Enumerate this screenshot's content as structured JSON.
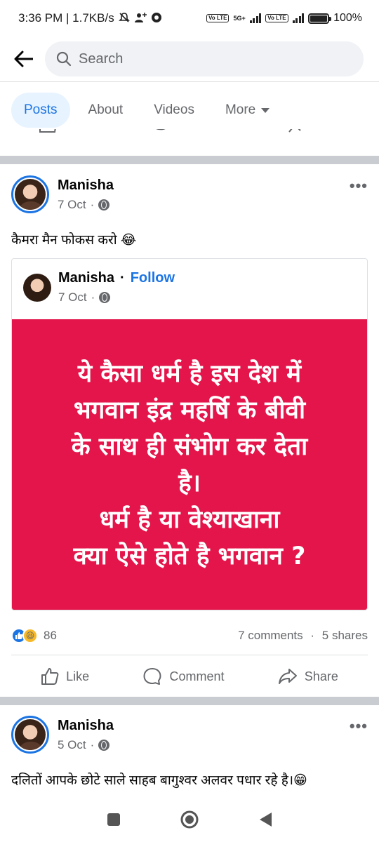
{
  "status_bar": {
    "time_info": "3:36 PM | 1.7KB/s",
    "battery": "100%",
    "battery_level": 1.0,
    "network_label": "5G+",
    "volte_label": "Vo LTE"
  },
  "search": {
    "placeholder": "Search"
  },
  "tabs": [
    {
      "label": "Posts",
      "active": true
    },
    {
      "label": "About",
      "active": false
    },
    {
      "label": "Videos",
      "active": false
    },
    {
      "label": "More",
      "active": false
    }
  ],
  "posts": [
    {
      "author": "Manisha",
      "date": "7 Oct",
      "separator": "·",
      "caption": "कैमरा मैन फोकस करो 😂",
      "shared": {
        "author": "Manisha",
        "follow_label": "Follow",
        "date": "7 Oct",
        "image_text": "ये कैसा धर्म है इस देश में\nभगवान इंद्र महर्षि के बीवी\nके साथ ही संभोग कर देता\nहै।\nधर्म है या वेश्याखाना\nक्या ऐसे होते है भगवान ?"
      },
      "reaction_count": "86",
      "comments": "7 comments",
      "shares": "5 shares",
      "actions": {
        "like": "Like",
        "comment": "Comment",
        "share": "Share"
      }
    },
    {
      "author": "Manisha",
      "date": "5 Oct",
      "separator": "·",
      "caption": "दलितों आपके छोटे साले साहब बागुश्वर अलवर पधार रहे है।😁"
    }
  ],
  "colors": {
    "accent": "#1b74e4",
    "image_bg": "#e3154a",
    "separator": "#c9ccd1"
  }
}
